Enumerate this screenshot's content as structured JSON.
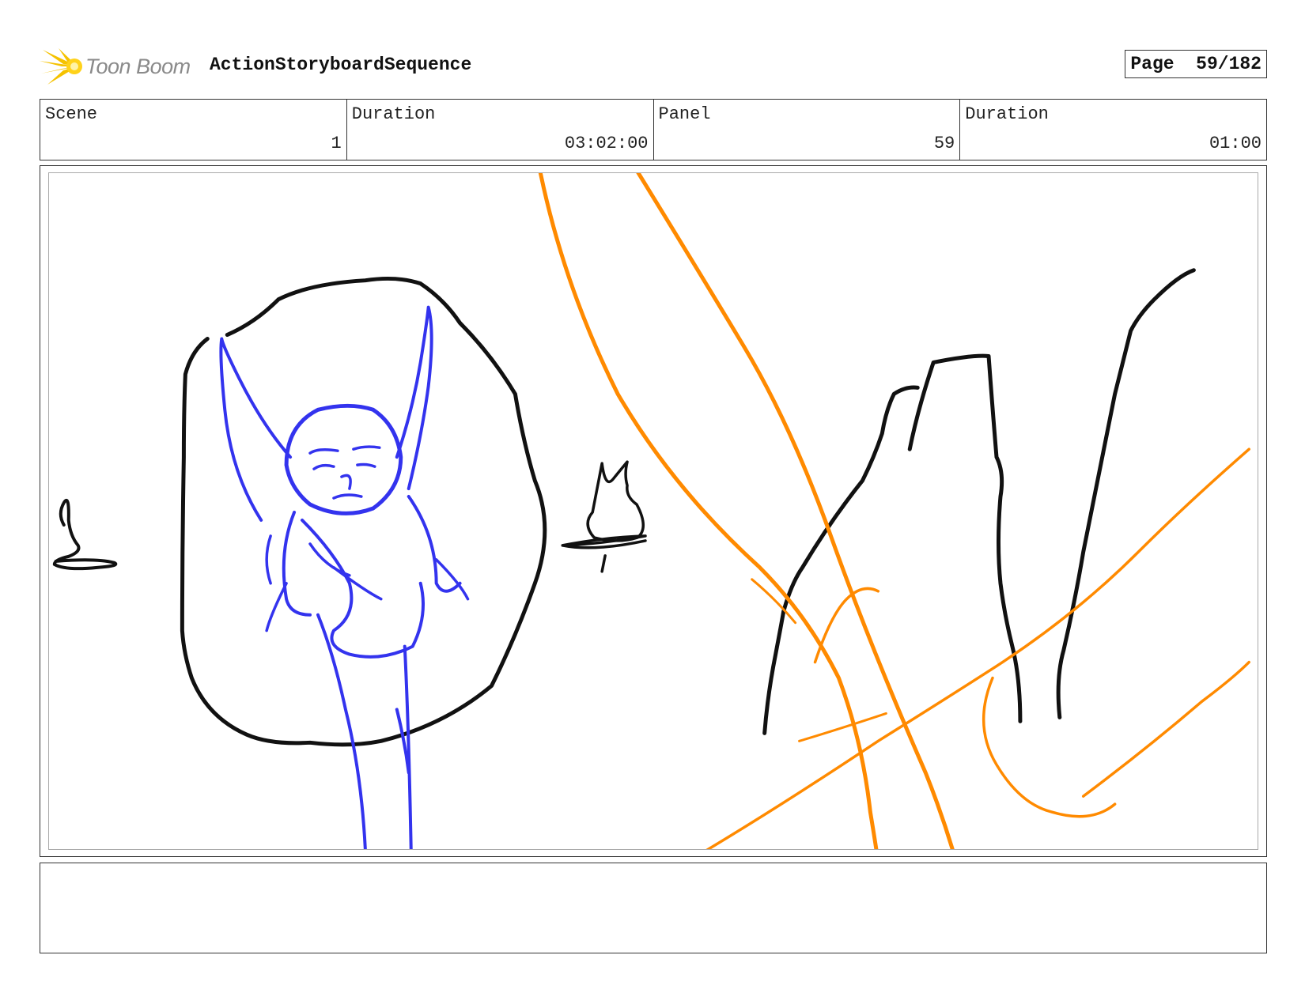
{
  "header": {
    "logo_text": "Toon Boom",
    "logo_icon": "toon-boom-star-icon",
    "title": "ActionStoryboardSequence",
    "page_label": "Page",
    "page_value": "59/182"
  },
  "info": {
    "scene_label": "Scene",
    "scene_value": "1",
    "scene_duration_label": "Duration",
    "scene_duration_value": "03:02:00",
    "panel_label": "Panel",
    "panel_value": "59",
    "panel_duration_label": "Duration",
    "panel_duration_value": "01:00"
  },
  "panel": {
    "drawing": "storyboard-sketch",
    "colors": {
      "character": "#3333ee",
      "background": "#111111",
      "guides": "#ff8a00"
    }
  },
  "notes": {
    "text": ""
  }
}
